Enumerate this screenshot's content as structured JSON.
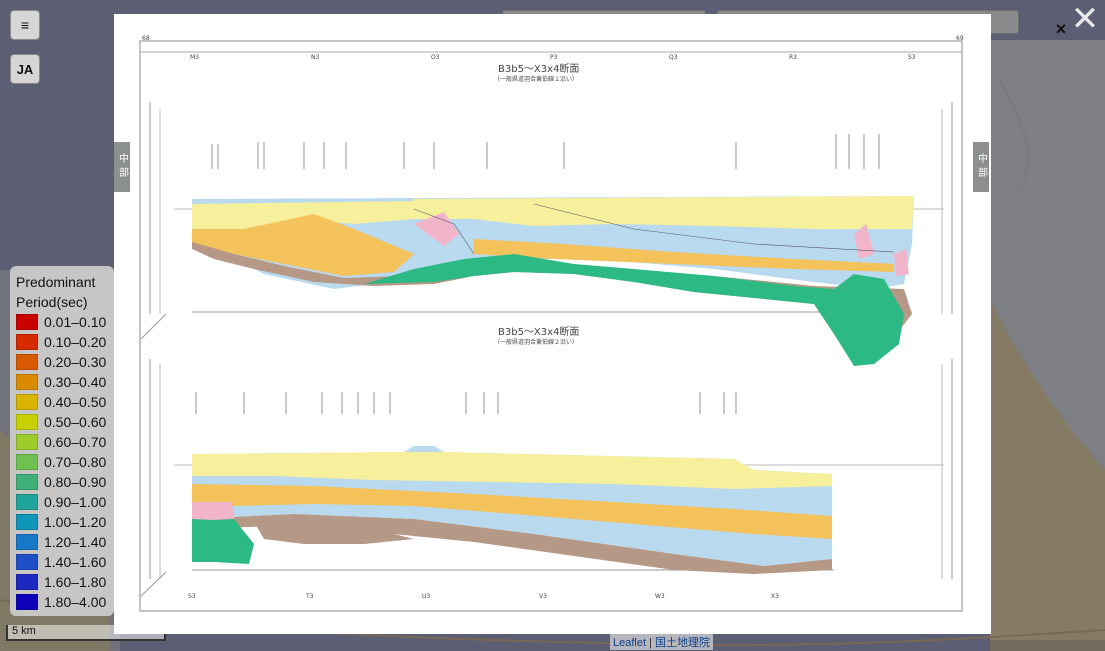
{
  "controls": {
    "menu_icon": "menu-icon",
    "menu_symbol": "≡",
    "language_label": "JA"
  },
  "legend": {
    "title_line1": "Predominant",
    "title_line2": "Period(sec)",
    "items": [
      {
        "label": "0.01–0.10",
        "color": "#c80000"
      },
      {
        "label": "0.10–0.20",
        "color": "#d82a00"
      },
      {
        "label": "0.20–0.30",
        "color": "#d85a00"
      },
      {
        "label": "0.30–0.40",
        "color": "#d88a00"
      },
      {
        "label": "0.40–0.50",
        "color": "#d8b400"
      },
      {
        "label": "0.50–0.60",
        "color": "#c8d000"
      },
      {
        "label": "0.60–0.70",
        "color": "#9ccc28"
      },
      {
        "label": "0.70–0.80",
        "color": "#6ec050"
      },
      {
        "label": "0.80–0.90",
        "color": "#40b078"
      },
      {
        "label": "0.90–1.00",
        "color": "#20a49c"
      },
      {
        "label": "1.00–1.20",
        "color": "#1096b8"
      },
      {
        "label": "1.20–1.40",
        "color": "#1878c8"
      },
      {
        "label": "1.40–1.60",
        "color": "#1f50c8"
      },
      {
        "label": "1.60–1.80",
        "color": "#1c28c0"
      },
      {
        "label": "1.80–4.00",
        "color": "#0c00b8"
      }
    ]
  },
  "scale_label": "5 km",
  "attribution": {
    "leaflet": "Leaflet",
    "separator": "|",
    "gsi": "国土地理院"
  },
  "lightbox": {
    "close_symbol": "×",
    "outer_close_symbol": "✕",
    "side_tab_left": "中部",
    "side_tab_right": "中部",
    "page_left": "68",
    "page_right": "69",
    "upper_title": "B3b5～X3x4断面",
    "upper_subtitle": "（一般県道羽合東伯線１沿い）",
    "lower_title": "B3b5～X3x4断面",
    "lower_subtitle": "（一般県道羽合東伯線２沿い）",
    "upper_grid_labels": [
      "M3",
      "N3",
      "O3",
      "P3",
      "Q3",
      "R3",
      "S3"
    ],
    "lower_grid_labels": [
      "S3",
      "T3",
      "U3",
      "V3",
      "W3",
      "X3"
    ]
  },
  "colors": {
    "backdrop": "#6f7385",
    "layer_yellow": "#f6ef9c",
    "layer_orange": "#f3c25a",
    "layer_blue": "#b9d9ee",
    "layer_brown": "#b59885",
    "layer_green": "#2cb984",
    "layer_pink": "#f2b4c8"
  }
}
